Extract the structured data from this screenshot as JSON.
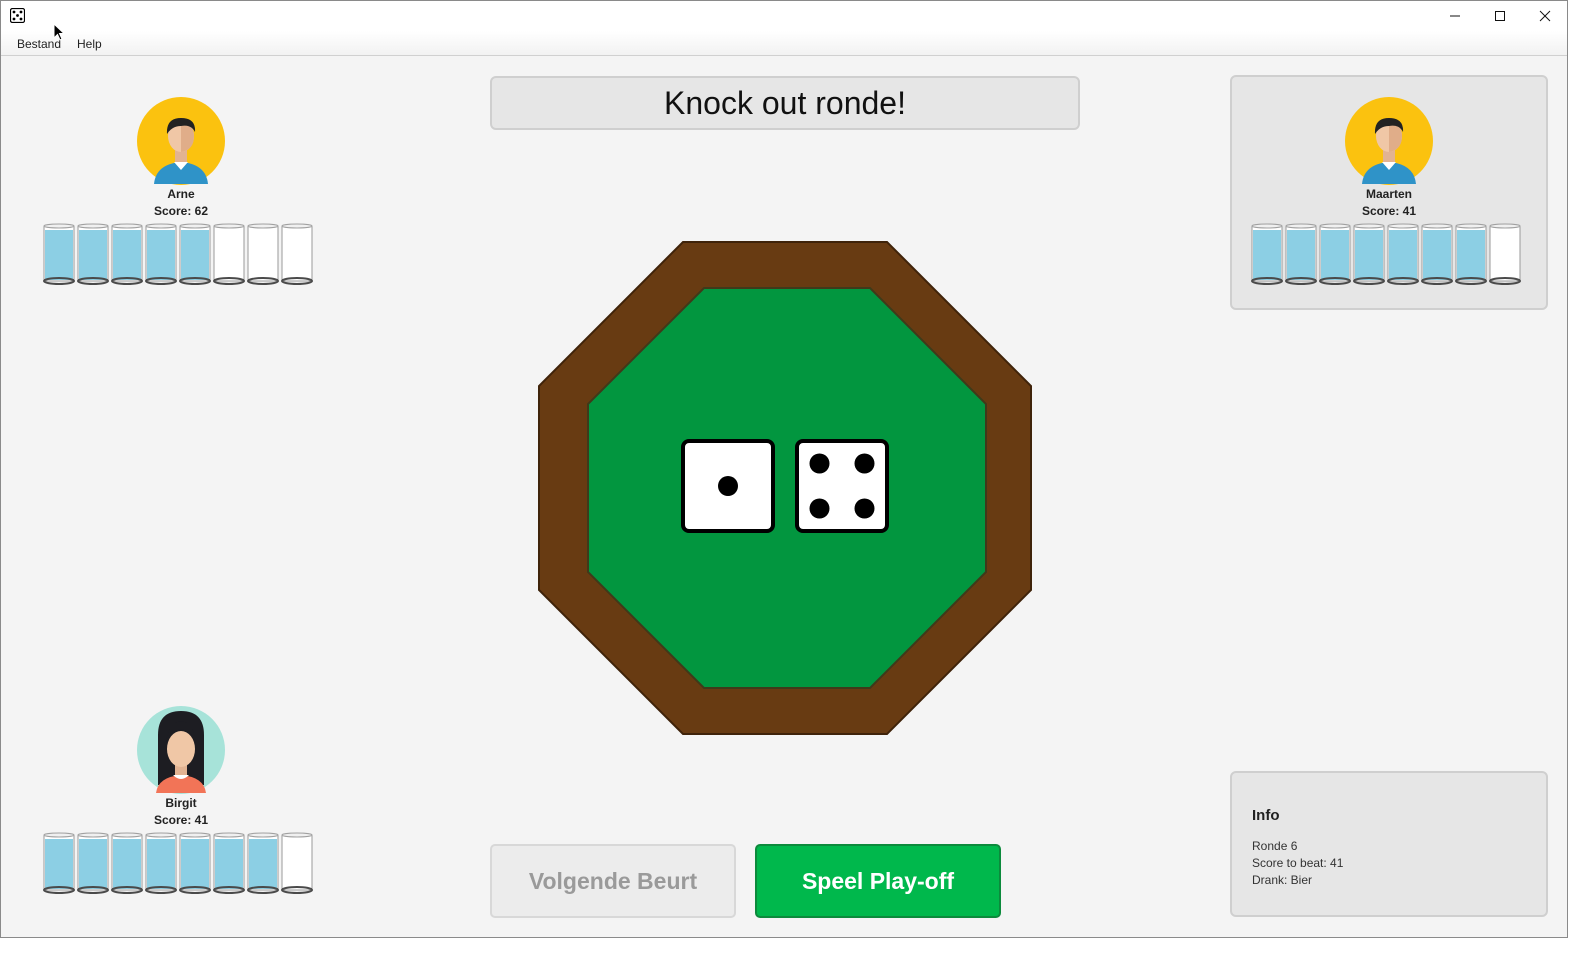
{
  "window": {
    "menu": [
      "Bestand",
      "Help"
    ]
  },
  "title": "Knock out ronde!",
  "players": [
    {
      "name": "Arne",
      "score_text": "Score: 62",
      "glasses_full": 5,
      "glasses_total": 8,
      "avatar": "male-avatar-icon"
    },
    {
      "name": "Maarten",
      "score_text": "Score: 41",
      "glasses_full": 7,
      "glasses_total": 8,
      "avatar": "male-avatar-icon"
    },
    {
      "name": "Birgit",
      "score_text": "Score: 41",
      "glasses_full": 7,
      "glasses_total": 8,
      "avatar": "female-avatar-icon"
    }
  ],
  "dice": [
    1,
    4
  ],
  "buttons": {
    "next_turn": "Volgende Beurt",
    "play_off": "Speel Play-off"
  },
  "info": {
    "title": "Info",
    "round": "Ronde 6",
    "score_to_beat": "Score to beat: 41",
    "drink": "Drank: Bier"
  },
  "colors": {
    "table_felt": "#02963f",
    "table_rim": "#683b12",
    "play_button": "#00b84c",
    "water": "#8ccfe4"
  }
}
